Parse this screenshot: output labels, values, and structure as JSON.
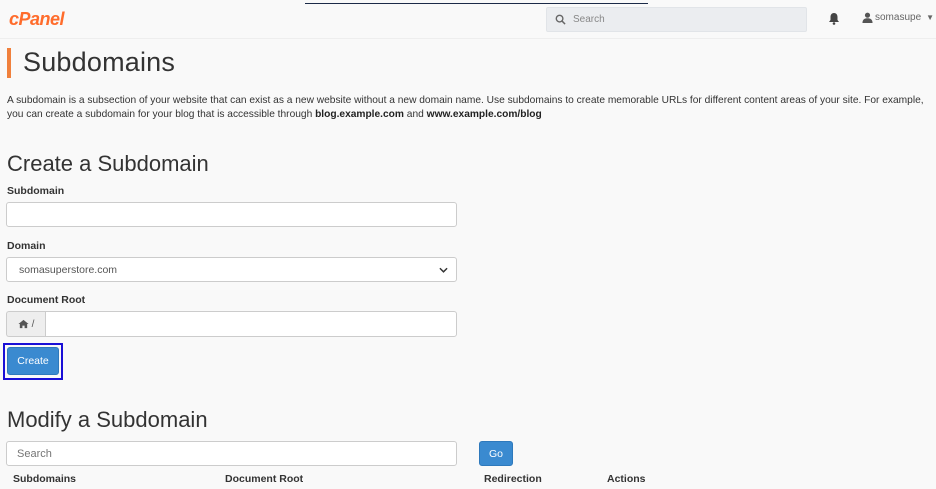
{
  "header": {
    "logo": "cPanel",
    "search_placeholder": "Search",
    "username": "somasupe"
  },
  "page": {
    "title": "Subdomains",
    "description_part1": "A subdomain is a subsection of your website that can exist as a new website without a new domain name. Use subdomains to create memorable URLs for different content areas of your site. For example, you can create a subdomain for your blog that is accessible through ",
    "description_link1": "blog.example.com",
    "description_and": " and ",
    "description_link2": "www.example.com/blog"
  },
  "create": {
    "heading": "Create a Subdomain",
    "subdomain_label": "Subdomain",
    "subdomain_value": "",
    "domain_label": "Domain",
    "domain_selected": "somasuperstore.com",
    "docroot_label": "Document Root",
    "docroot_prefix": "/",
    "docroot_value": "",
    "create_button": "Create"
  },
  "modify": {
    "heading": "Modify a Subdomain",
    "search_placeholder": "Search",
    "go_button": "Go",
    "columns": [
      "Subdomains",
      "Document Root",
      "Redirection",
      "Actions"
    ]
  },
  "colors": {
    "brand": "#ff6c2c",
    "primary_button": "#3a8ad0",
    "focus_ring": "#1a0fd6",
    "title_accent": "#f0803c"
  },
  "icons": [
    "search-icon",
    "bell-icon",
    "user-icon",
    "caret-down-icon",
    "chevron-down-icon",
    "home-icon"
  ]
}
